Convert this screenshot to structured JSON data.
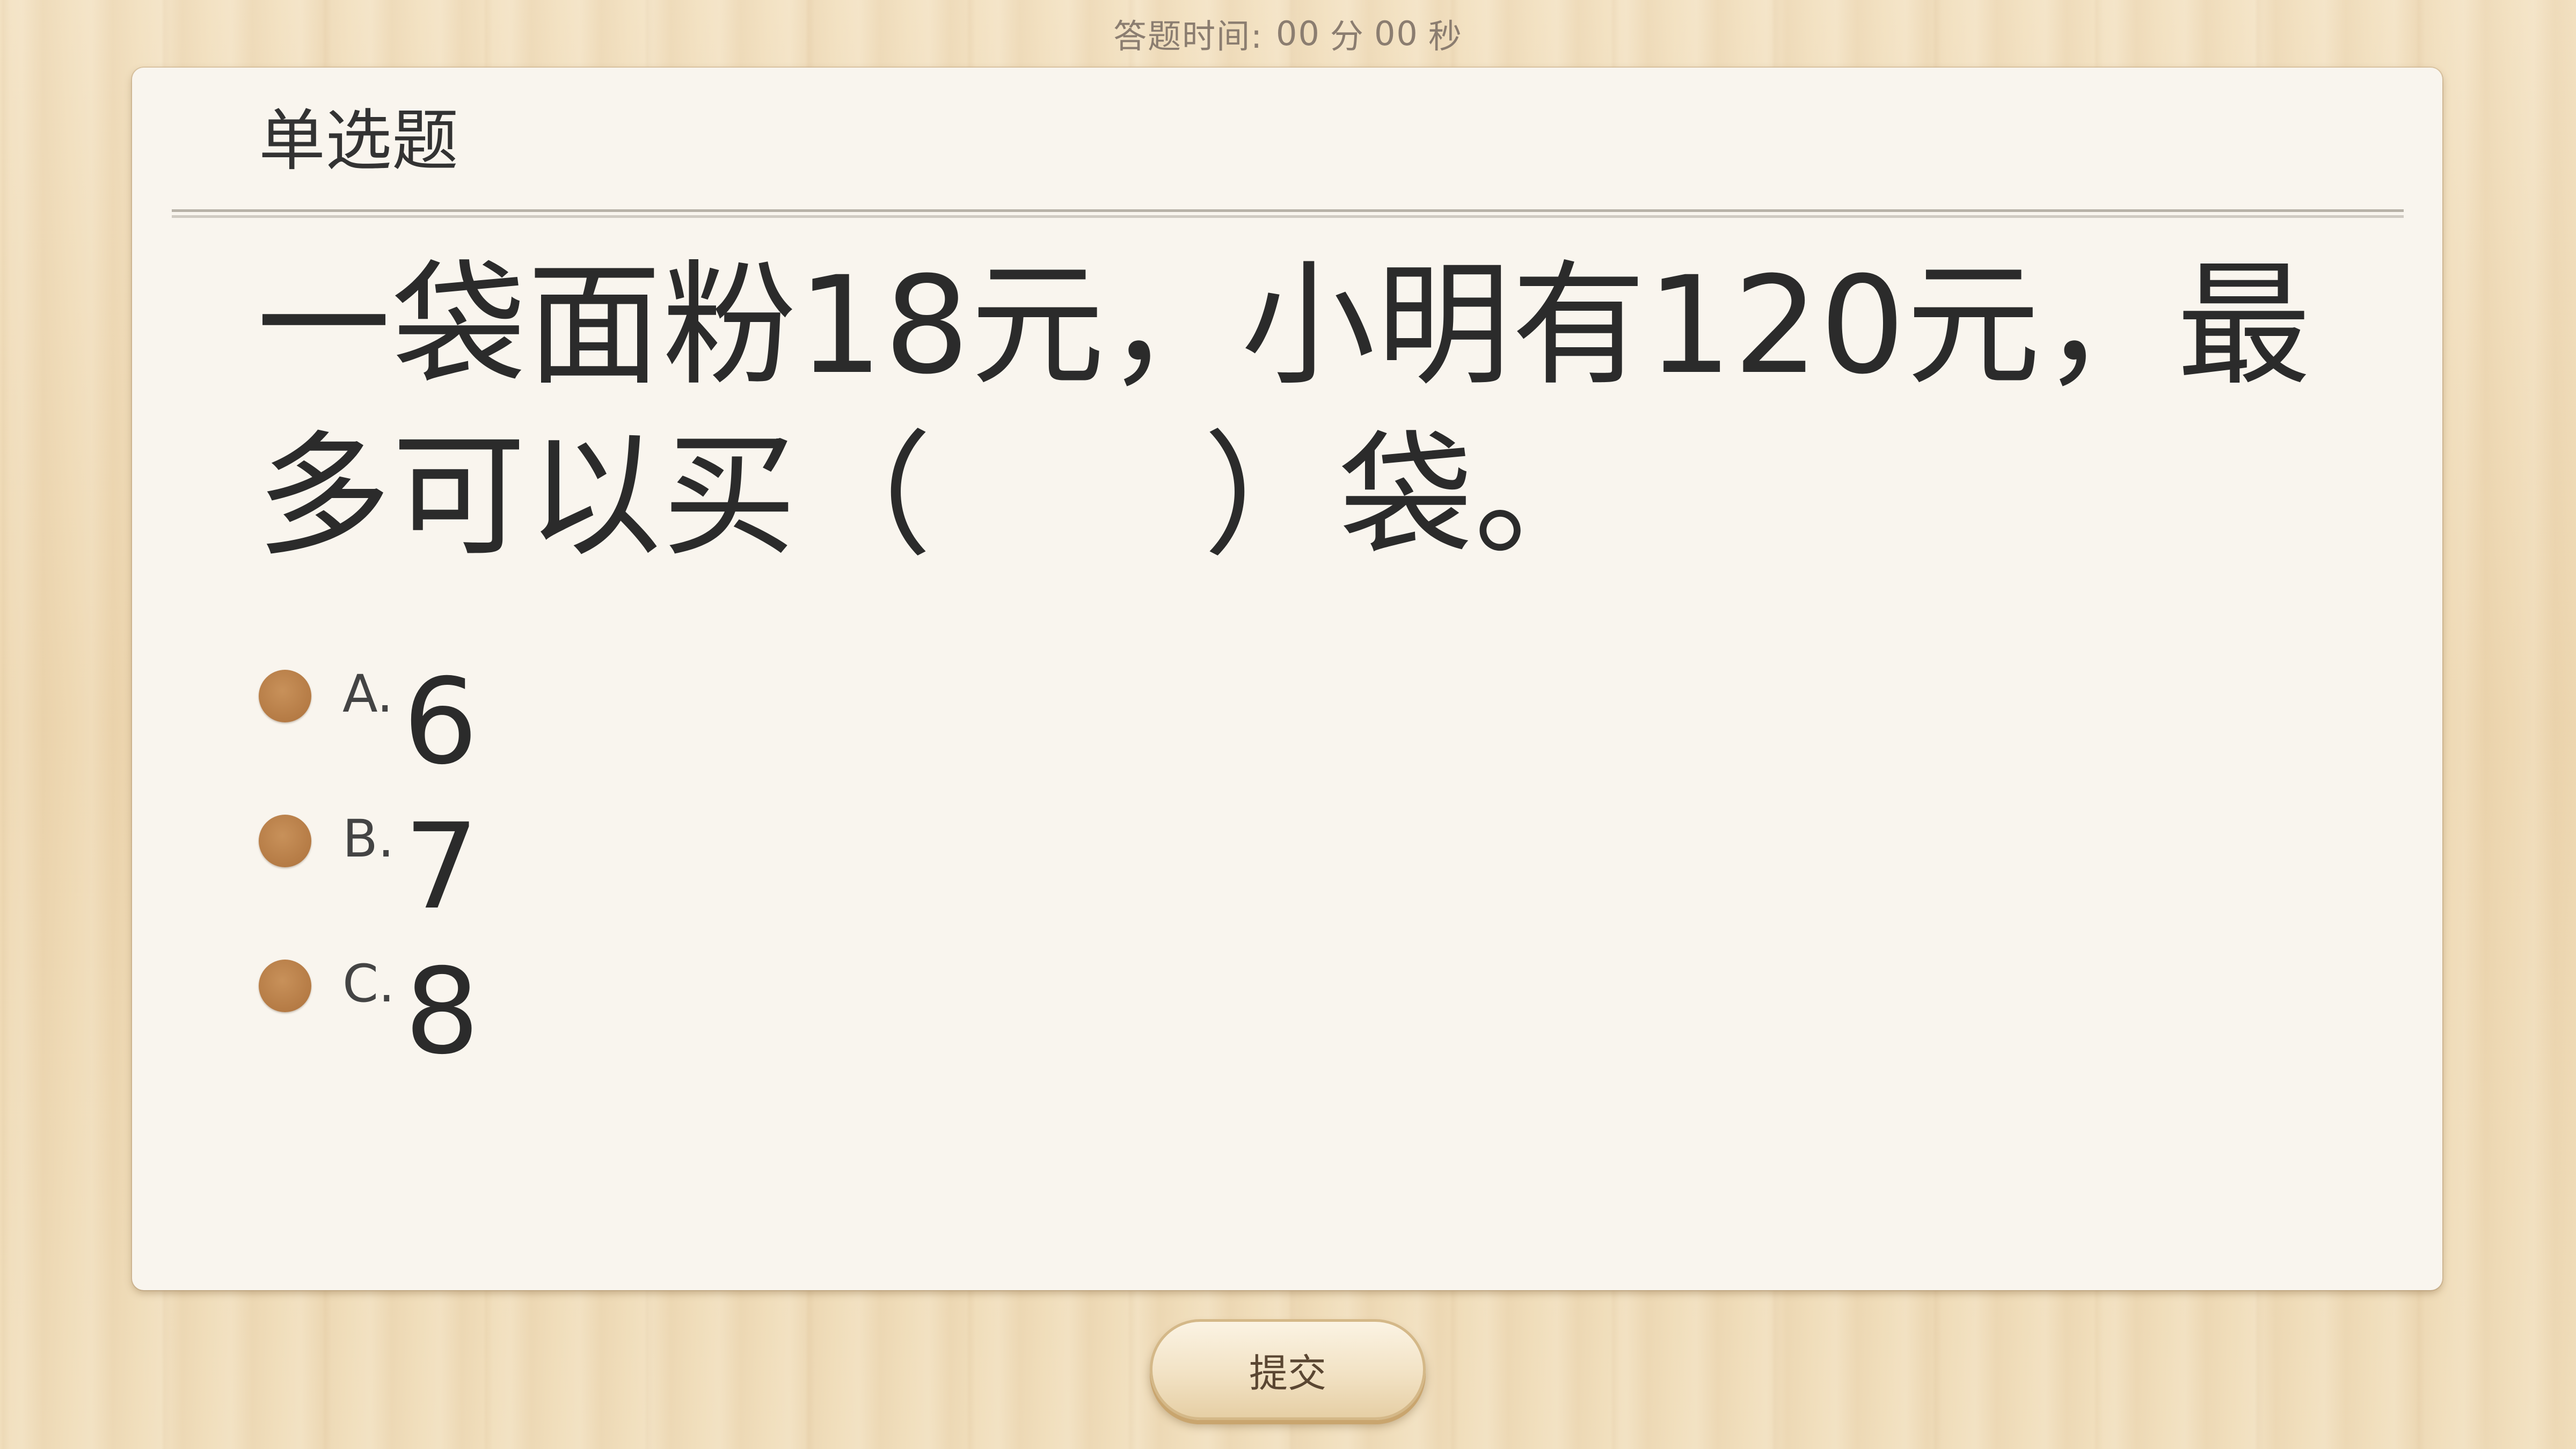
{
  "timer": {
    "label": "答题时间:",
    "minutes": "00",
    "minutes_unit": "分",
    "seconds": "00",
    "seconds_unit": "秒"
  },
  "question": {
    "type_label": "单选题",
    "text": "一袋面粉18元，小明有120元，最多可以买（　　）袋。"
  },
  "options": [
    {
      "letter": "A.",
      "value": "6"
    },
    {
      "letter": "B.",
      "value": "7"
    },
    {
      "letter": "C.",
      "value": "8"
    }
  ],
  "submit_label": "提交",
  "colors": {
    "background": "#f0dcb9",
    "card": "#f9f5ee",
    "radio": "#b57b45",
    "text": "#2b2b2b"
  }
}
